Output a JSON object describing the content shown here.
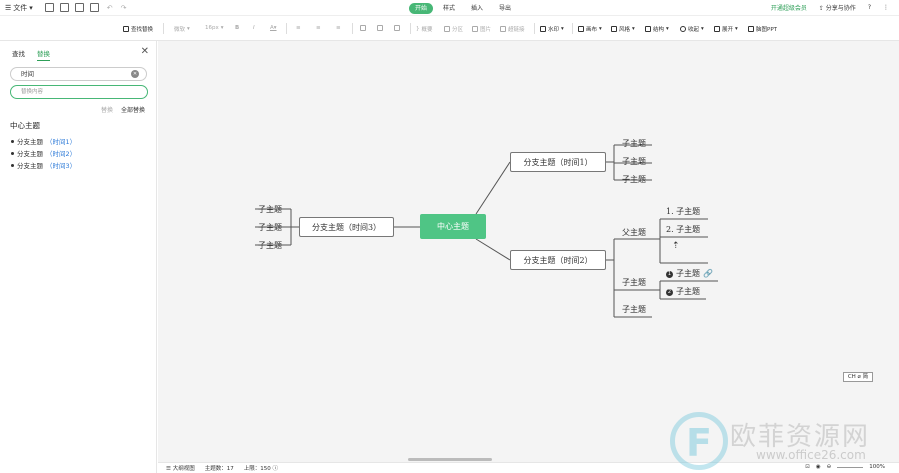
{
  "menubar": {
    "file_label": "文件",
    "tabs": [
      "开始",
      "样式",
      "插入",
      "导出"
    ],
    "active_tab": "开始",
    "vip_label": "开通超级会员",
    "share_label": "分享与协作",
    "help_label": "?"
  },
  "toolbar": {
    "find_replace": "查找替换",
    "font_family": "微软",
    "font_size": "16px",
    "outline": "概要",
    "section": "分区",
    "image": "图片",
    "hyperlink": "超链接",
    "watermark": "水印",
    "layout": "画布",
    "style": "风格",
    "structure": "结构",
    "collapse": "收起",
    "expand": "展开",
    "ppt": "脑图PPT"
  },
  "panel": {
    "tabs": [
      "查找",
      "替换"
    ],
    "active_tab": "替换",
    "search_value": "时间",
    "replace_placeholder": "替换内容",
    "replace_label": "替换",
    "replace_all_label": "全部替换",
    "results_title": "中心主题",
    "results": [
      {
        "text": "分支主题",
        "match": "（时间1）"
      },
      {
        "text": "分支主题",
        "match": "（时间2）"
      },
      {
        "text": "分支主题",
        "match": "（时间3）"
      }
    ]
  },
  "mindmap": {
    "center": "中心主题",
    "branch1": "分支主题（时间1）",
    "branch2": "分支主题（时间2）",
    "branch3": "分支主题（时间3）",
    "sub": "子主题",
    "parent": "父主题",
    "sub_num1": "1. 子主题",
    "sub_num2": "2. 子主题",
    "badge1": "1",
    "badge2": "2"
  },
  "status": {
    "outline_label": "大纲视图",
    "topic_count_label": "主题数：",
    "topic_count": "17",
    "limit_label": "上限：",
    "limit": "150",
    "zoom": "100%",
    "ime": "CH ⌀ 简"
  },
  "watermark": {
    "cn": "欧菲资源网",
    "url": "www.office26.com"
  },
  "colors": {
    "accent": "#47b776",
    "center_node": "#4fc585",
    "link": "#2e7bd8"
  }
}
